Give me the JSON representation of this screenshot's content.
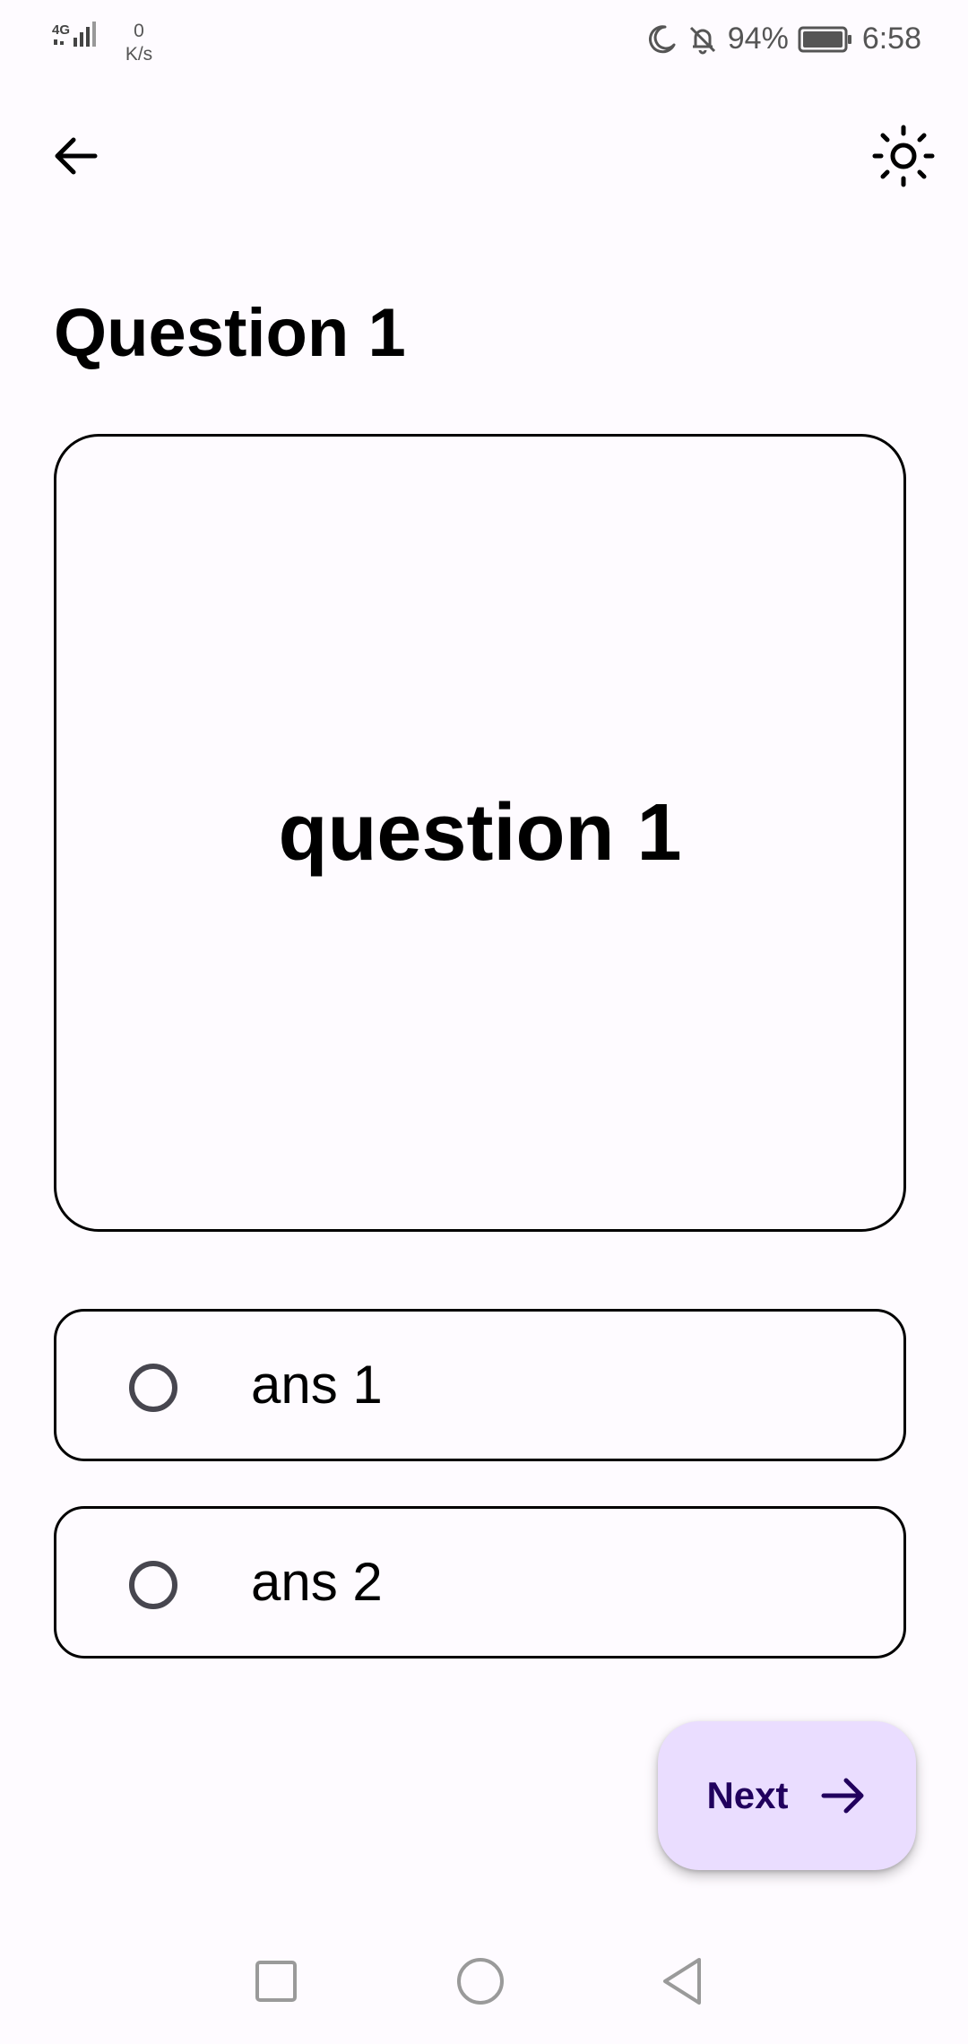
{
  "status_bar": {
    "network_type": "4G",
    "net_speed_value": "0",
    "net_speed_unit": "K/s",
    "battery_percent": "94%",
    "time": "6:58",
    "icons": [
      "signal-icon",
      "moon-icon",
      "bell-off-icon",
      "battery-icon"
    ]
  },
  "top_bar": {
    "back_icon": "arrow-left-icon",
    "theme_icon": "sun-icon"
  },
  "page": {
    "title": "Question 1"
  },
  "question": {
    "text": "question 1"
  },
  "options": [
    {
      "label": "ans 1",
      "selected": false
    },
    {
      "label": "ans 2",
      "selected": false
    }
  ],
  "next_button": {
    "label": "Next",
    "icon": "arrow-right-icon",
    "background_color": "#eaddff",
    "text_color": "#21005d"
  },
  "nav_bar": {
    "icons": [
      "square-recents-icon",
      "circle-home-icon",
      "triangle-back-icon"
    ]
  }
}
